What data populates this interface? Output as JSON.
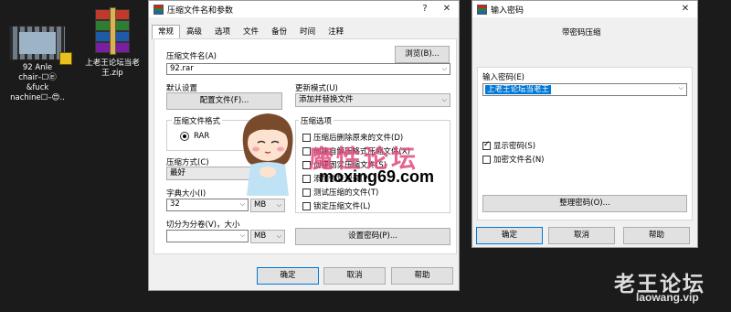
{
  "desktop": {
    "video_icon": {
      "label_lines": [
        "92 Anle",
        "chair–☐㉫",
        "&fuck",
        "nachine☐–😍.."
      ]
    },
    "zip_icon": {
      "label_lines": [
        "上老王论坛当老",
        "王.zip"
      ]
    }
  },
  "archive_dialog": {
    "title": "压缩文件名和参数",
    "controls": {
      "help": "?",
      "close": "✕"
    },
    "tabs": [
      "常规",
      "高级",
      "选项",
      "文件",
      "备份",
      "时间",
      "注释"
    ],
    "active_tab": "常规",
    "archive_name_label": "压缩文件名(A)",
    "browse_button": "浏览(B)...",
    "archive_name_value": "92.rar",
    "default_settings_label": "默认设置",
    "profiles_button": "配置文件(F)...",
    "update_mode_label": "更新模式(U)",
    "update_mode_value": "添加并替换文件",
    "format_group_label": "压缩文件格式",
    "format_rar": "RAR",
    "options_group_label": "压缩选项",
    "options": [
      {
        "label": "压缩后删除原来的文件(D)",
        "checked": false
      },
      {
        "label": "创建自解压格式压缩文件(X)",
        "checked": false
      },
      {
        "label": "创建固实压缩文件(S)",
        "checked": false
      },
      {
        "label": "添加恢复记录(P)",
        "checked": false
      },
      {
        "label": "测试压缩的文件(T)",
        "checked": false
      },
      {
        "label": "锁定压缩文件(L)",
        "checked": false
      }
    ],
    "method_label": "压缩方式(C)",
    "method_value": "最好",
    "dict_label": "字典大小(I)",
    "dict_value": "32",
    "dict_unit": "MB",
    "split_label": "切分为分卷(V)，大小",
    "split_value": "",
    "split_unit": "MB",
    "set_password_button": "设置密码(P)...",
    "ok_button": "确定",
    "cancel_button": "取消",
    "help_button": "帮助"
  },
  "password_dialog": {
    "title": "输入密码",
    "controls": {
      "close": "✕"
    },
    "heading": "带密码压缩",
    "input_label": "输入密码(E)",
    "input_value": "上老王论坛当老王",
    "show_password_label": "显示密码(S)",
    "show_password_checked": true,
    "encrypt_names_label": "加密文件名(N)",
    "encrypt_names_checked": false,
    "manage_button": "整理密码(O)...",
    "ok_button": "确定",
    "cancel_button": "取消",
    "help_button": "帮助"
  },
  "watermarks": {
    "magic_site": "魔性论坛",
    "magic_url": "moxing69.com",
    "logo_text": "老王论坛",
    "logo_url": "laowang.vip"
  }
}
